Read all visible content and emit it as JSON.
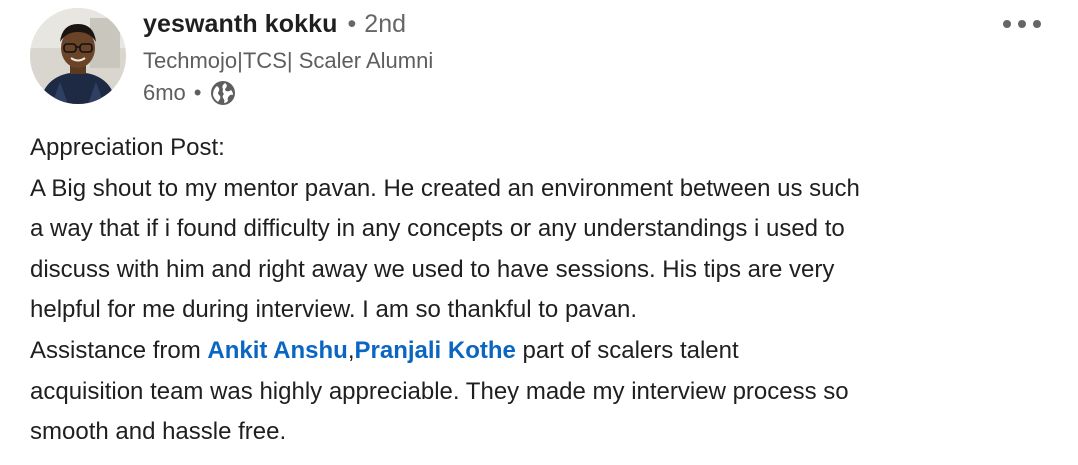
{
  "author": {
    "name": "yeswanth kokku",
    "separator": "•",
    "degree": "2nd",
    "headline": "Techmojo|TCS| Scaler Alumni",
    "time": "6mo",
    "time_separator": "•",
    "visibility_icon": "globe-icon"
  },
  "menu": {
    "icon": "more-horizontal-icon"
  },
  "post": {
    "line1": "Appreciation Post:",
    "line2": "A Big shout to my mentor pavan. He created an environment between us such",
    "line3": "a way that if i found difficulty in any concepts or any understandings i used to",
    "line4": "discuss with him and right away we used to have sessions. His tips are very",
    "line5": "helpful for me during interview. I am so thankful to pavan.",
    "line6_prefix": "Assistance from ",
    "mention1": "Ankit Anshu",
    "comma": ",",
    "mention2": "Pranjali Kothe",
    "line6_suffix": " part of scalers talent",
    "line7": "acquisition team was highly appreciable. They made my interview process so",
    "line8": "smooth and hassle free."
  },
  "colors": {
    "link": "#0a66c2",
    "text": "#1f1f1f",
    "secondary": "#5e5e5e"
  }
}
